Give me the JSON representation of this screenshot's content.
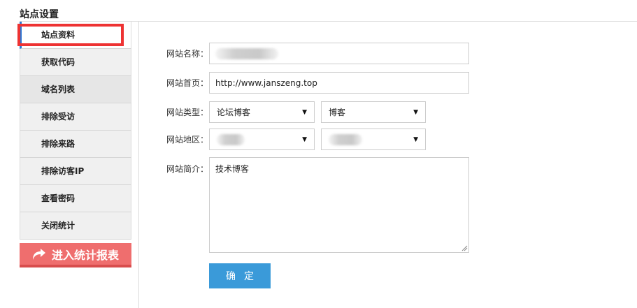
{
  "header": {
    "title": "站点设置"
  },
  "sidebar": {
    "items": [
      {
        "label": "站点资料",
        "active": true
      },
      {
        "label": "获取代码"
      },
      {
        "label": "域名列表"
      },
      {
        "label": "排除受访"
      },
      {
        "label": "排除来路"
      },
      {
        "label": "排除访客IP"
      },
      {
        "label": "查看密码"
      },
      {
        "label": "关闭统计"
      }
    ],
    "report_button": {
      "label": "进入统计报表",
      "icon": "redo-arrow-icon"
    }
  },
  "form": {
    "site_name": {
      "label": "网站名称：",
      "value": ""
    },
    "homepage": {
      "label": "网站首页：",
      "value": "http://www.janszeng.top"
    },
    "site_type": {
      "label": "网站类型：",
      "primary": "论坛博客",
      "secondary": "博客"
    },
    "region": {
      "label": "网站地区：",
      "primary": "",
      "secondary": ""
    },
    "intro": {
      "label": "网站简介：",
      "value": "技术博客"
    },
    "submit_label": "确定"
  },
  "colors": {
    "accent": "#2a78d6",
    "highlight": "#ee3333",
    "report_button": "#ef6e6e",
    "submit_button": "#3a9ad9"
  }
}
